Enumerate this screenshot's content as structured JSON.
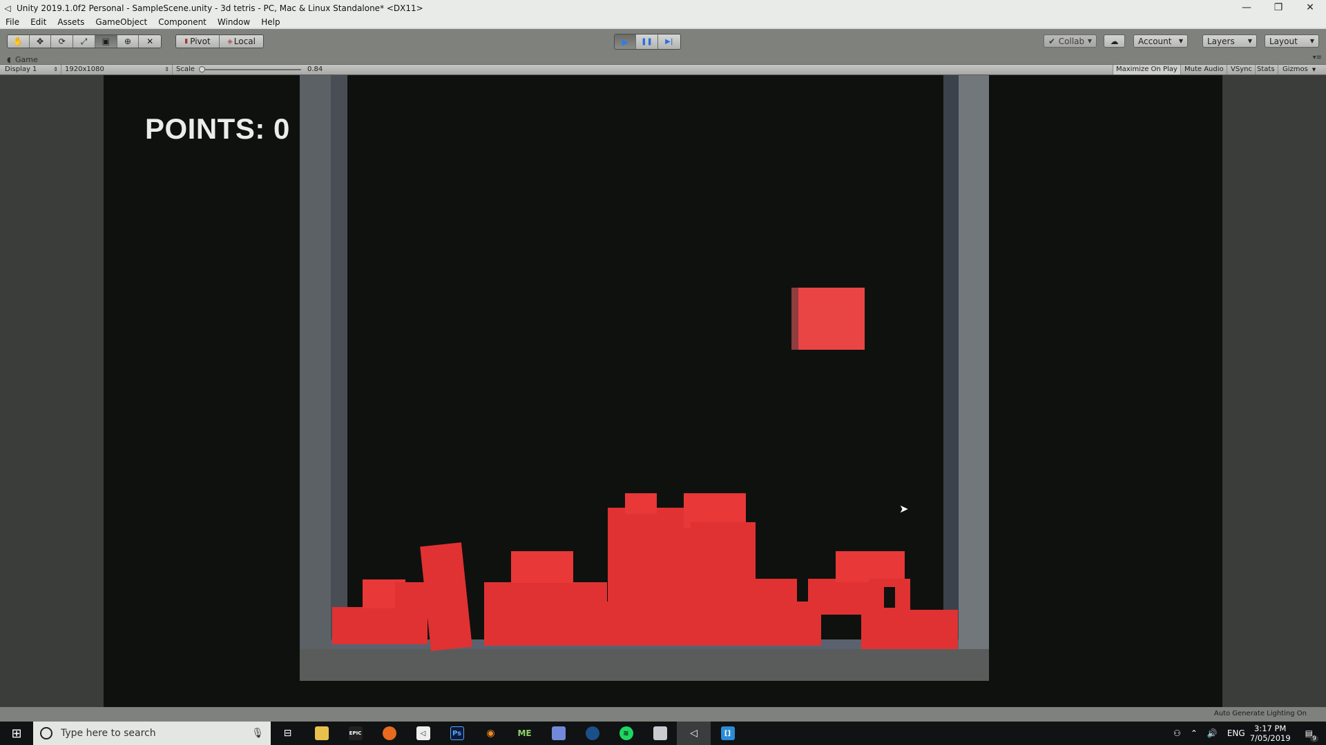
{
  "window": {
    "title": "Unity 2019.1.0f2 Personal - SampleScene.unity - 3d tetris - PC, Mac & Linux Standalone* <DX11>",
    "controls": {
      "minimize": "—",
      "restore": "❐",
      "close": "✕"
    }
  },
  "menu": [
    "File",
    "Edit",
    "Assets",
    "GameObject",
    "Component",
    "Window",
    "Help"
  ],
  "toolbar": {
    "tools": [
      {
        "name": "hand-tool",
        "glyph": "✋"
      },
      {
        "name": "move-tool",
        "glyph": "✥"
      },
      {
        "name": "rotate-tool",
        "glyph": "⟳"
      },
      {
        "name": "scale-tool",
        "glyph": "⤢"
      },
      {
        "name": "rect-tool",
        "glyph": "▣"
      },
      {
        "name": "transform-tool",
        "glyph": "⊕"
      },
      {
        "name": "custom-tool",
        "glyph": "✕"
      }
    ],
    "active_tool": "rect-tool",
    "pivot_label": "Pivot",
    "local_label": "Local",
    "play": {
      "play_glyph": "▶",
      "pause_glyph": "❚❚",
      "step_glyph": "▶|",
      "playing": true
    },
    "collab_label": "Collab",
    "account_label": "Account",
    "layers_label": "Layers",
    "layout_label": "Layout"
  },
  "game_tab": {
    "label": "Game",
    "display": "Display 1",
    "resolution": "1920x1080",
    "scale_label": "Scale",
    "scale_value": "0.84",
    "options": [
      "Maximize On Play",
      "Mute Audio",
      "VSync",
      "Stats",
      "Gizmos"
    ]
  },
  "game": {
    "points_text": "POINTS: 0",
    "colors": {
      "block": "#e03232",
      "background": "#0f110e",
      "frame": "#5c6166"
    }
  },
  "status": {
    "text": "Auto Generate Lighting On"
  },
  "taskbar": {
    "search_placeholder": "Type here to search",
    "apps": [
      "Task View",
      "File Explorer",
      "Epic Games",
      "Firefox",
      "Unity Hub",
      "Photoshop",
      "Blender",
      "MagicaVoxel",
      "Discord",
      "Steam",
      "Spotify",
      "Resource Monitor",
      "Unity",
      "Brackets"
    ],
    "tray": {
      "language": "ENG",
      "time": "3:17 PM",
      "date": "7/05/2019",
      "notifications": "9"
    }
  }
}
